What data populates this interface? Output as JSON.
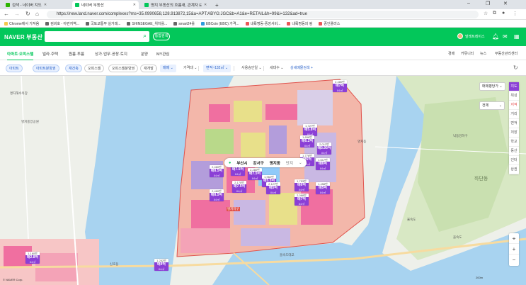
{
  "browser": {
    "tabs": [
      {
        "label": "검색 - 네이버 지도",
        "active": false,
        "color": "#2db400"
      },
      {
        "label": "네이버 부동산",
        "active": true,
        "color": "#03c75a"
      },
      {
        "label": "명지 부동산의 흐름새, 관계자 E",
        "active": false,
        "color": "#03c75a"
      }
    ],
    "new_tab": "+",
    "url": "https://new.land.naver.com/complexes?ms=35.0990658,128.913872,15&a=APT:ABYG:JGC&b=A1&e=RETAIL&h=99&i=132&ad=true",
    "bookmarks": [
      {
        "label": "Chrome에서 가져옴",
        "color": "#f2c94c"
      },
      {
        "label": "컴비호 - 아련지역...",
        "color": "#666"
      },
      {
        "label": "국토교통부 실거래...",
        "color": "#666"
      },
      {
        "label": "SHINSEGAE_위치를...",
        "color": "#666"
      },
      {
        "label": "smart24를",
        "color": "#666"
      },
      {
        "label": "EBCoin (EBC) 가격...",
        "color": "#2d9cdb"
      },
      {
        "label": "내륙명동-중앙서비...",
        "color": "#eb5757"
      },
      {
        "label": "내륙명동의 링",
        "color": "#eb5757"
      },
      {
        "label": "중인플러스",
        "color": "#eb5757"
      }
    ]
  },
  "header": {
    "logo_brand": "NAVER",
    "logo_service": "부동산",
    "search_placeholder": "",
    "complex_search": "통합검색",
    "user_name": "발레트레이스",
    "icons": [
      "bell-icon",
      "mail-icon",
      "grid-icon"
    ]
  },
  "menu": {
    "items": [
      "아파트·오피스텔",
      "빌라·주택",
      "원룸·투룸",
      "상가·업무·공장·토지",
      "분양",
      "MY관심"
    ],
    "right_items": [
      "경매",
      "커뮤니티",
      "뉴스",
      "부동산관리센터"
    ]
  },
  "filters": {
    "chips": [
      "아파트",
      "아파트분양권",
      "재건축",
      "오피스텔",
      "오피스텔분양권",
      "재개발"
    ],
    "chips_on": [
      true,
      true,
      true,
      false,
      false,
      false
    ],
    "dropdowns": [
      "매매",
      "가격대",
      "면적~132㎡",
      "사용승인일",
      "세대수"
    ],
    "dropdowns_on": [
      true,
      false,
      true,
      false,
      false
    ],
    "cond_link": "상세매물검색 +",
    "refresh_icon": "refresh-icon"
  },
  "map": {
    "location": {
      "city": "부산시",
      "district": "강서구",
      "dong": "명지동",
      "unit": "단지"
    },
    "map_type": "매매평당가",
    "scope": "전체",
    "right_controls": [
      "지도",
      "위성",
      "지적",
      "거리",
      "면적",
      "저장",
      "학교",
      "동산",
      "인터",
      "상권"
    ],
    "labels": [
      "명지해수욕장",
      "명지교",
      "하단동",
      "율숙도",
      "율숙도대교",
      "을숙도대교",
      "신호동",
      "을숙도",
      "낙동강하구",
      "명지동",
      "명지지구",
      "녹산산업",
      "부산신항선",
      "르노삼성",
      "명지중앙공원",
      "에코델타시티",
      "명지오션시티"
    ],
    "pins": [
      {
        "count": "2,480만",
        "price": "매7억",
        "area": "84㎡"
      },
      {
        "count": "1,727만",
        "price": "매5.8억",
        "area": "84㎡"
      },
      {
        "count": "1,656만",
        "price": "매6.2억",
        "area": "84㎡"
      },
      {
        "count": "2,012만",
        "price": "매5.95억",
        "area": "84㎡"
      },
      {
        "count": "1,778만",
        "price": "매6억",
        "area": "84㎡"
      },
      {
        "count": "1,617만",
        "price": "매6억",
        "area": "84㎡"
      },
      {
        "count": "2,460만",
        "price": "매8.5억",
        "area": "84㎡"
      },
      {
        "count": "2,132만",
        "price": "매7.5억",
        "area": "84㎡"
      },
      {
        "count": "2,280만",
        "price": "매7.5억",
        "area": "84㎡"
      },
      {
        "count": "1,962만",
        "price": "매5.5억",
        "area": "84㎡"
      },
      {
        "count": "2,170만",
        "price": "매7.5억",
        "area": "84㎡"
      },
      {
        "count": "2,127만",
        "price": "매5억",
        "area": "84㎡"
      },
      {
        "count": "1,753만",
        "price": "매6억",
        "area": "84㎡"
      },
      {
        "count": "1,458만",
        "price": "매5억",
        "area": "84㎡"
      },
      {
        "count": "2,068만",
        "price": "매7억",
        "area": "84㎡"
      },
      {
        "count": "2,460만",
        "price": "매8.5억",
        "area": "84㎡"
      },
      {
        "count": "1,252만",
        "price": "매4억",
        "area": "84㎡"
      },
      {
        "count": "1,180만",
        "price": "매2.8억",
        "area": "84㎡"
      }
    ],
    "scale": "200m",
    "logo": "© NAVER Corp."
  }
}
